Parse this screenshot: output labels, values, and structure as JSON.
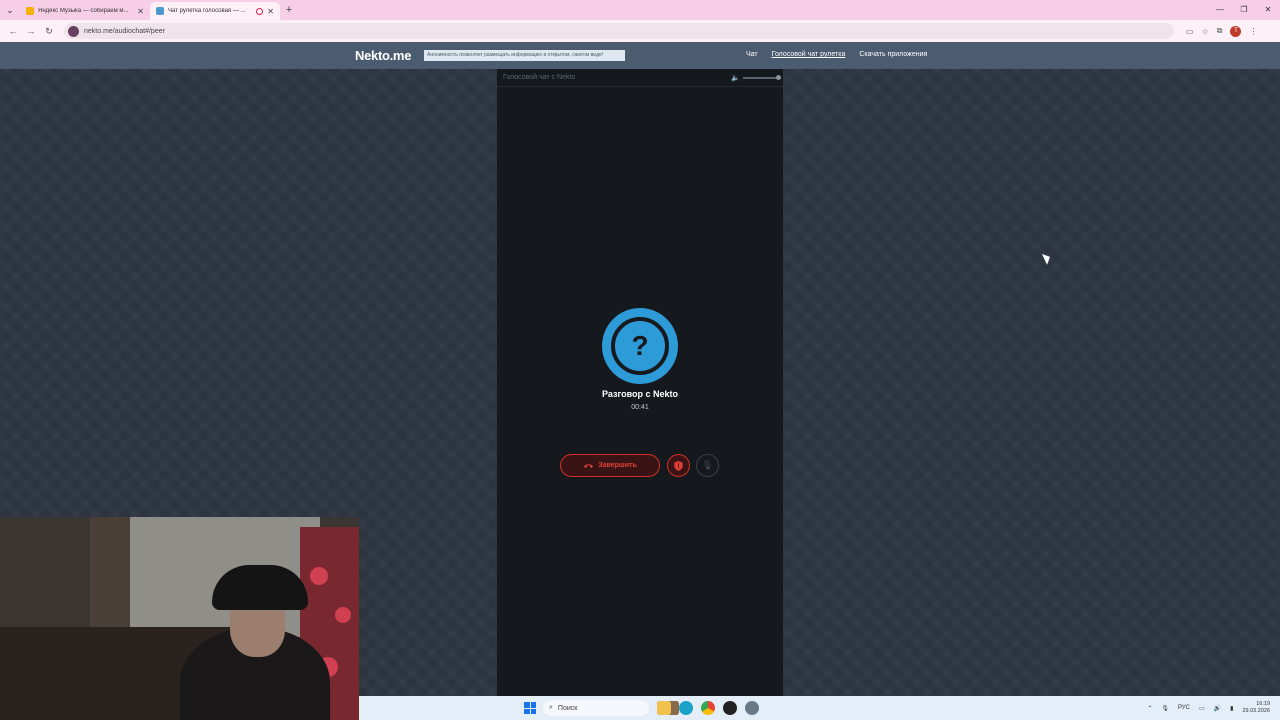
{
  "browser": {
    "tabs": [
      {
        "title": "Яндекс Музыка — собираем м...",
        "favicon": "yandex-music-icon",
        "active": false
      },
      {
        "title": "Чат рулетка голосовая — ...",
        "favicon": "nekto-icon",
        "active": true,
        "recording": true
      }
    ],
    "new_tab": "+",
    "address": "nekto.me/audiochat#/peer",
    "profile_initial": "Т"
  },
  "site": {
    "logo": "Nekto.me",
    "notice": "Анонимность позволяет размещать информацию в открытом, сжатом виде!",
    "nav": [
      {
        "label": "Чат",
        "current": false
      },
      {
        "label": "Голосовой чат рулетка",
        "current": true
      },
      {
        "label": "Скачать приложения",
        "current": false
      }
    ]
  },
  "panel": {
    "header": "Голосовой чат с Nekto",
    "avatar_symbol": "?",
    "peer_name": "Разговор с Nekto",
    "timer": "00:41",
    "end_label": "Завершить",
    "volume_level": 1.0
  },
  "taskbar": {
    "search_placeholder": "Поиск",
    "lang": "РУС",
    "time": "16:19",
    "date": "29.03.2026"
  },
  "colors": {
    "accent": "#2d9bd8",
    "danger": "#d03028",
    "header_bg": "#4b5b70",
    "panel_bg": "#15191e"
  }
}
